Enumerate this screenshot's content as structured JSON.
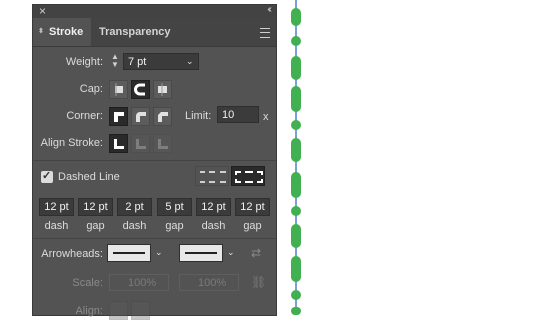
{
  "panel": {
    "tabs": [
      {
        "label": "Stroke",
        "active": true
      },
      {
        "label": "Transparency",
        "active": false
      }
    ]
  },
  "weight": {
    "label": "Weight:",
    "value": "7 pt"
  },
  "cap": {
    "label": "Cap:",
    "options": [
      "butt-cap-icon",
      "round-cap-icon",
      "projecting-cap-icon"
    ],
    "selected": 1
  },
  "corner": {
    "label": "Corner:",
    "limit_label": "Limit:",
    "limit_value": "10",
    "limit_unit": "x"
  },
  "align_stroke": {
    "label": "Align Stroke:"
  },
  "dashed": {
    "label": "Dashed Line",
    "checked": true,
    "values": [
      "12 pt",
      "12 pt",
      "2 pt",
      "5 pt",
      "12 pt",
      "12 pt"
    ],
    "labels": [
      "dash",
      "gap",
      "dash",
      "gap",
      "dash",
      "gap"
    ]
  },
  "arrowheads": {
    "label": "Arrowheads:"
  },
  "scale": {
    "label": "Scale:",
    "start": "100%",
    "end": "100%"
  },
  "align": {
    "label": "Align:"
  },
  "colors": {
    "panel_bg": "#535353",
    "accent_stroke": "#40b050",
    "guide": "#7aa0d8"
  }
}
